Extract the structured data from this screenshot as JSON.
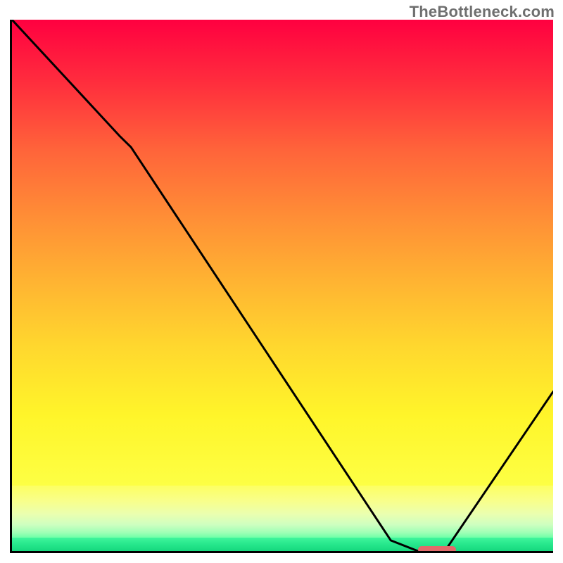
{
  "watermark": "TheBottleneck.com",
  "chart_data": {
    "type": "line",
    "title": "",
    "xlabel": "",
    "ylabel": "",
    "xlim": [
      0,
      100
    ],
    "ylim": [
      0,
      100
    ],
    "series": [
      {
        "name": "curve",
        "x": [
          0,
          20,
          22,
          70,
          75,
          80,
          100
        ],
        "values": [
          100,
          78,
          76,
          2,
          0,
          0,
          30
        ]
      }
    ],
    "marker": {
      "x_start": 75,
      "x_end": 82,
      "y": 0
    },
    "gradient_bands_pct": {
      "red_to_yellow_end": 87.7,
      "transition_end": 97.5,
      "green_end": 100
    }
  }
}
